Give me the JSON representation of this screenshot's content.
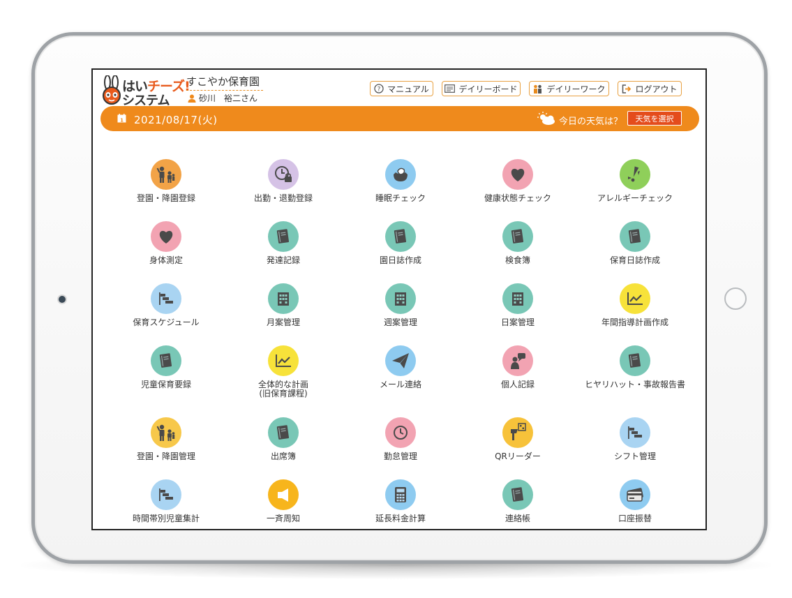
{
  "app": {
    "logo_line1_a": "はい",
    "logo_line1_b": "チーズ!",
    "logo_line2": "システム",
    "facility_name": "すこやか保育園",
    "user_name": "砂川　裕二さん"
  },
  "toolbar": {
    "manual": "マニュアル",
    "daily_board": "デイリーボード",
    "daily_work": "デイリーワーク",
    "logout": "ログアウト"
  },
  "datebar": {
    "date": "2021/08/17(火)",
    "weather_question": "今日の天気は？",
    "weather_button": "天気を選択"
  },
  "colors": {
    "orange": "#ef8a1c",
    "teal": "#79c7b6",
    "blue": "#8ecbf0",
    "pink": "#f2a3b2",
    "yellow": "#f7d94a",
    "purple": "#d5c2e6",
    "green": "#8fcf5a"
  },
  "menu": [
    {
      "label": "登園・降園登録",
      "icon": "family-icon",
      "color": "#f2a347"
    },
    {
      "label": "出勤・退勤登録",
      "icon": "clock-lock-icon",
      "color": "#d5c2e6"
    },
    {
      "label": "睡眠チェック",
      "icon": "sleep-icon",
      "color": "#8ecbf0"
    },
    {
      "label": "健康状態チェック",
      "icon": "heart-icon",
      "color": "#f2a3b2"
    },
    {
      "label": "アレルギーチェック",
      "icon": "alert-icon",
      "color": "#8fcf5a"
    },
    {
      "label": "身体測定",
      "icon": "heart-icon",
      "color": "#f2a3b2"
    },
    {
      "label": "発達記録",
      "icon": "book-icon",
      "color": "#79c7b6"
    },
    {
      "label": "園日誌作成",
      "icon": "book-icon",
      "color": "#79c7b6"
    },
    {
      "label": "検食簿",
      "icon": "book-icon",
      "color": "#79c7b6"
    },
    {
      "label": "保育日誌作成",
      "icon": "book-icon",
      "color": "#79c7b6"
    },
    {
      "label": "保育スケジュール",
      "icon": "schedule-icon",
      "color": "#a9d4f2"
    },
    {
      "label": "月案管理",
      "icon": "building-icon",
      "color": "#79c7b6"
    },
    {
      "label": "週案管理",
      "icon": "building-icon",
      "color": "#79c7b6"
    },
    {
      "label": "日案管理",
      "icon": "building-icon",
      "color": "#79c7b6"
    },
    {
      "label": "年間指導計画作成",
      "icon": "chart-icon",
      "color": "#f7e23a"
    },
    {
      "label": "児童保育要録",
      "icon": "book-icon",
      "color": "#79c7b6"
    },
    {
      "label": "全体的な計画",
      "label2": "(旧保育課程)",
      "icon": "chart-icon",
      "color": "#f7e23a"
    },
    {
      "label": "メール連絡",
      "icon": "paper-plane-icon",
      "color": "#8ecbf0"
    },
    {
      "label": "個人記録",
      "icon": "person-speech-icon",
      "color": "#f2a3b2"
    },
    {
      "label": "ヒヤリハット・事故報告書",
      "icon": "book-icon",
      "color": "#79c7b6"
    },
    {
      "label": "登園・降園管理",
      "icon": "family-icon",
      "color": "#f7c84a"
    },
    {
      "label": "出席簿",
      "icon": "book-icon",
      "color": "#79c7b6"
    },
    {
      "label": "勤怠管理",
      "icon": "clock-icon",
      "color": "#f2a3b2"
    },
    {
      "label": "QRリーダー",
      "icon": "qr-reader-icon",
      "color": "#f7c23a"
    },
    {
      "label": "シフト管理",
      "icon": "schedule-icon",
      "color": "#a9d4f2"
    },
    {
      "label": "時間帯別児童集計",
      "icon": "schedule-icon",
      "color": "#a9d4f2"
    },
    {
      "label": "一斉周知",
      "icon": "megaphone-icon",
      "color": "#f7b51c"
    },
    {
      "label": "延長料金計算",
      "icon": "calculator-icon",
      "color": "#8ecbf0"
    },
    {
      "label": "連絡帳",
      "icon": "book-icon",
      "color": "#79c7b6"
    },
    {
      "label": "口座振替",
      "icon": "card-icon",
      "color": "#8ecbf0"
    }
  ]
}
